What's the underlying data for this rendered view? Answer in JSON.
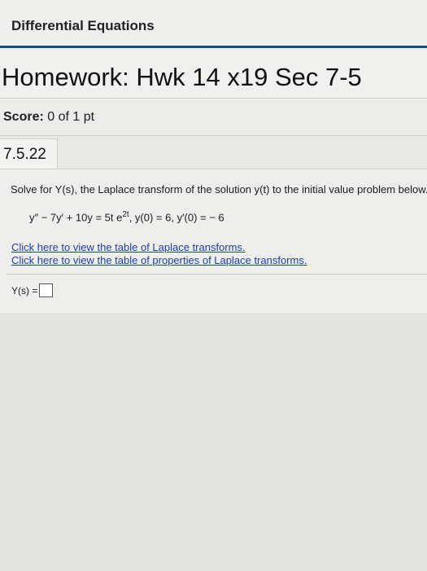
{
  "course": {
    "title": "Differential Equations"
  },
  "homework": {
    "title": "Homework: Hwk 14 x19 Sec 7-5"
  },
  "score": {
    "label": "Score:",
    "value": "0 of 1 pt"
  },
  "question": {
    "number": "7.5.22",
    "prompt": "Solve for Y(s), the Laplace transform of the solution y(t) to the initial value problem below.",
    "equation_lhs": "y″ − 7y′ + 10y = 5t e",
    "equation_exp": "2t",
    "equation_rest": ", y(0) = 6, y′(0) = − 6",
    "link_table": "Click here to view the table of Laplace transforms.",
    "link_properties": "Click here to view the table of properties of Laplace transforms.",
    "answer_label": "Y(s) ="
  }
}
